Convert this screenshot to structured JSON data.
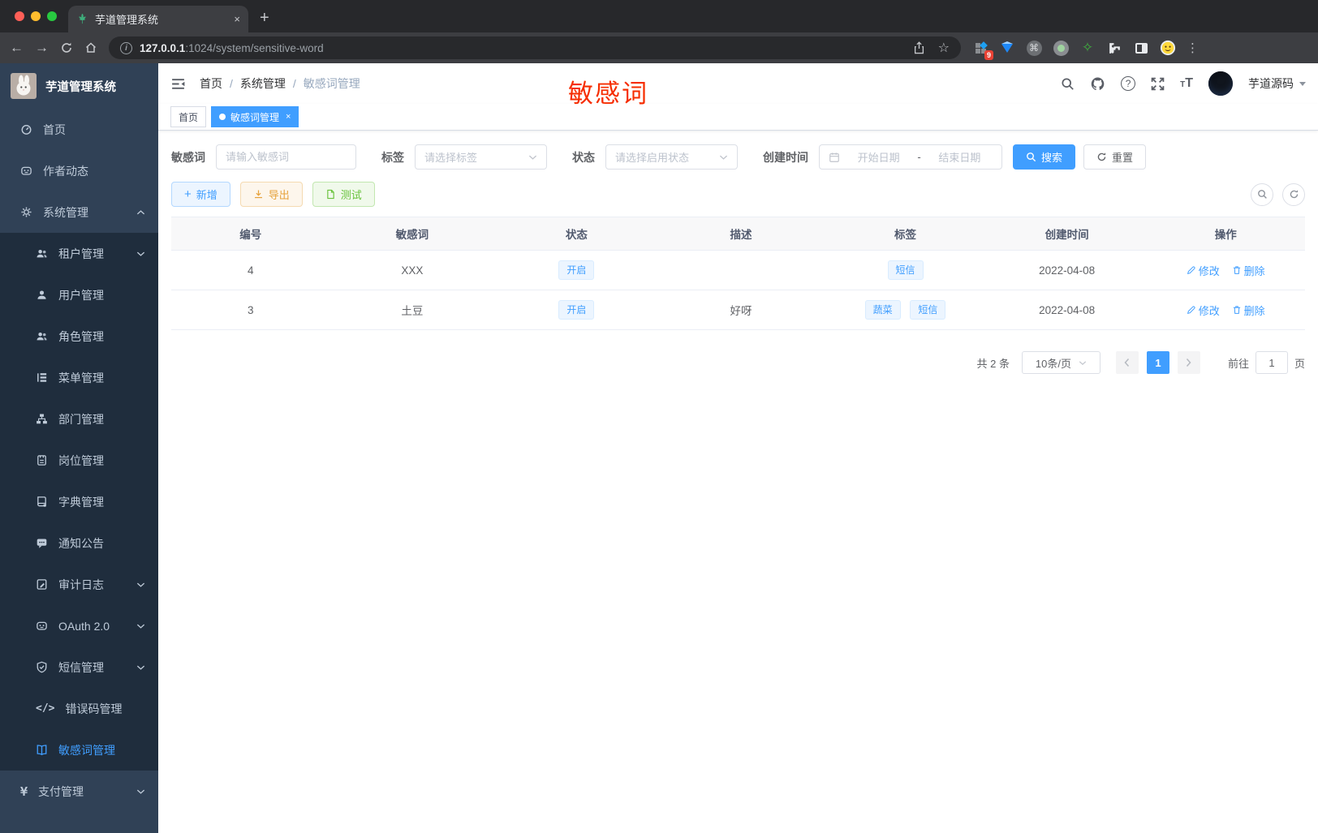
{
  "browser": {
    "tab_title": "芋道管理系统",
    "tab_close": "×",
    "new_tab": "+",
    "url_host": "127.0.0.1",
    "url_rest": ":1024/system/sensitive-word",
    "ext_badge": "9",
    "kebab": "⋮"
  },
  "sidebar": {
    "title": "芋道管理系统",
    "items": [
      {
        "label": "首页"
      },
      {
        "label": "作者动态"
      },
      {
        "label": "系统管理"
      },
      {
        "label": "租户管理"
      },
      {
        "label": "用户管理"
      },
      {
        "label": "角色管理"
      },
      {
        "label": "菜单管理"
      },
      {
        "label": "部门管理"
      },
      {
        "label": "岗位管理"
      },
      {
        "label": "字典管理"
      },
      {
        "label": "通知公告"
      },
      {
        "label": "审计日志"
      },
      {
        "label": "OAuth 2.0"
      },
      {
        "label": "短信管理"
      },
      {
        "label": "错误码管理"
      },
      {
        "label": "敏感词管理"
      },
      {
        "label": "支付管理"
      }
    ],
    "errcode_glyph": "</>",
    "pay_glyph": "¥"
  },
  "header": {
    "breadcrumb": [
      "首页",
      "系统管理",
      "敏感词管理"
    ],
    "separator": "/",
    "username": "芋道源码",
    "annotation": "敏感词"
  },
  "tags": {
    "home": "首页",
    "active": "敏感词管理",
    "close": "×"
  },
  "filters": {
    "keyword_label": "敏感词",
    "keyword_placeholder": "请输入敏感词",
    "tag_label": "标签",
    "tag_placeholder": "请选择标签",
    "status_label": "状态",
    "status_placeholder": "请选择启用状态",
    "date_label": "创建时间",
    "date_start": "开始日期",
    "date_separator": "-",
    "date_end": "结束日期",
    "search_label": "搜索",
    "reset_label": "重置"
  },
  "actions": {
    "add": "新增",
    "export": "导出",
    "test": "测试"
  },
  "table": {
    "headers": [
      "编号",
      "敏感词",
      "状态",
      "描述",
      "标签",
      "创建时间",
      "操作"
    ],
    "rows": [
      {
        "id": "4",
        "word": "XXX",
        "status": "开启",
        "desc": "",
        "tags": [
          "短信"
        ],
        "created": "2022-04-08"
      },
      {
        "id": "3",
        "word": "土豆",
        "status": "开启",
        "desc": "好呀",
        "tags": [
          "蔬菜",
          "短信"
        ],
        "created": "2022-04-08"
      }
    ],
    "op_edit": "修改",
    "op_delete": "删除"
  },
  "pagination": {
    "total": "共 2 条",
    "page_size": "10条/页",
    "current_page": "1",
    "goto_prefix": "前往",
    "goto_value": "1",
    "goto_suffix": "页"
  },
  "colors": {
    "accent": "#409eff",
    "annotation_red": "#f62d00",
    "sidebar_bg": "#304156",
    "submenu_bg": "#1f2d3d"
  }
}
